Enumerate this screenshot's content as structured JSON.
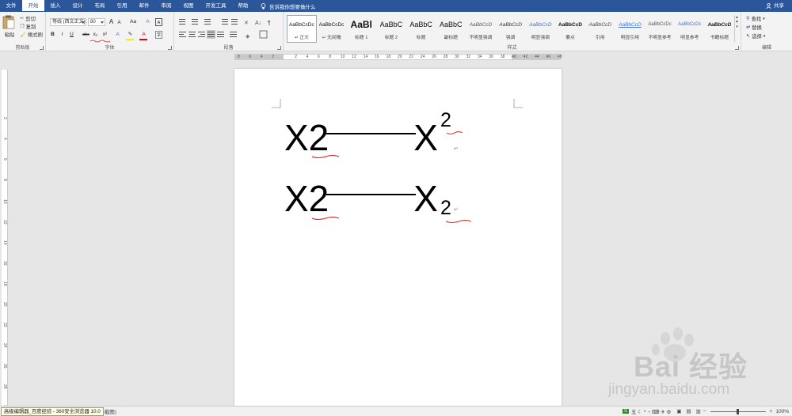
{
  "tabs": [
    "文件",
    "开始",
    "插入",
    "设计",
    "布局",
    "引用",
    "邮件",
    "审阅",
    "视图",
    "开发工具",
    "帮助"
  ],
  "active_tab": "开始",
  "tell_me": "告诉我你想要做什么",
  "share": "共享",
  "clipboard": {
    "paste": "粘贴",
    "cut": "剪切",
    "copy": "复制",
    "format_painter": "格式刷",
    "label": "剪贴板"
  },
  "font": {
    "family": "等线 (西文正文)",
    "size": "80",
    "grow": "A",
    "shrink": "A",
    "case": "Aa",
    "bold": "B",
    "italic": "I",
    "underline": "U",
    "strike": "abc",
    "subscript": "x₂",
    "superscript": "x²",
    "label": "字体"
  },
  "paragraph": {
    "label": "段落"
  },
  "styles": {
    "label": "样式",
    "items": [
      {
        "sample": "AaBbCcDc",
        "name": "↵ 正文",
        "selected": true
      },
      {
        "sample": "AaBbCcDc",
        "name": "↵ 无间隔"
      },
      {
        "sample": "AaBl",
        "name": "标题 1"
      },
      {
        "sample": "AaBbC",
        "name": "标题 2"
      },
      {
        "sample": "AaBbC",
        "name": "标题"
      },
      {
        "sample": "AaBbC",
        "name": "副标题"
      },
      {
        "sample": "AaBbCcD",
        "name": "不明显强调"
      },
      {
        "sample": "AaBbCcD",
        "name": "强调"
      },
      {
        "sample": "AaBbCcD",
        "name": "明显强调"
      },
      {
        "sample": "AaBbCcD",
        "name": "要点"
      },
      {
        "sample": "AaBbCcD",
        "name": "引用"
      },
      {
        "sample": "AaBbCcD",
        "name": "明显引用"
      },
      {
        "sample": "AaBbCcDc",
        "name": "不明显参考"
      },
      {
        "sample": "AaBbCcDc",
        "name": "明显参考"
      },
      {
        "sample": "AaBbCcD",
        "name": "书籍标题"
      }
    ]
  },
  "editing": {
    "find": "查找",
    "replace": "替换",
    "select": "选择",
    "label": "编辑"
  },
  "ruler_h": [
    "8",
    "6",
    "4",
    "2",
    "",
    "2",
    "4",
    "6",
    "8",
    "10",
    "12",
    "14",
    "16",
    "18",
    "20",
    "22",
    "24",
    "26",
    "28",
    "30",
    "32",
    "34",
    "36",
    "38",
    "40",
    "42",
    "44",
    "46",
    "48"
  ],
  "ruler_v": [
    "2",
    "4",
    "6",
    "8",
    "10",
    "12",
    "14",
    "16",
    "18",
    "20",
    "22",
    "24",
    "26",
    "28",
    "30"
  ],
  "document": {
    "line1": {
      "base": "X2",
      "right_base": "X",
      "sup": "2"
    },
    "line2": {
      "base": "X2",
      "right_base": "X",
      "sub": "2"
    },
    "para_mark": "↵"
  },
  "status": {
    "tooltip": "高级编辑器_百度经验 - 360安全浏览器 10.0",
    "tip_suffix": "截图)",
    "zoom": "100%"
  },
  "watermark": {
    "brand": "Bai 经验",
    "url": "jingyan.baidu.com"
  },
  "colors": {
    "accent": "#2b579a",
    "squiggle": "#e02020"
  }
}
